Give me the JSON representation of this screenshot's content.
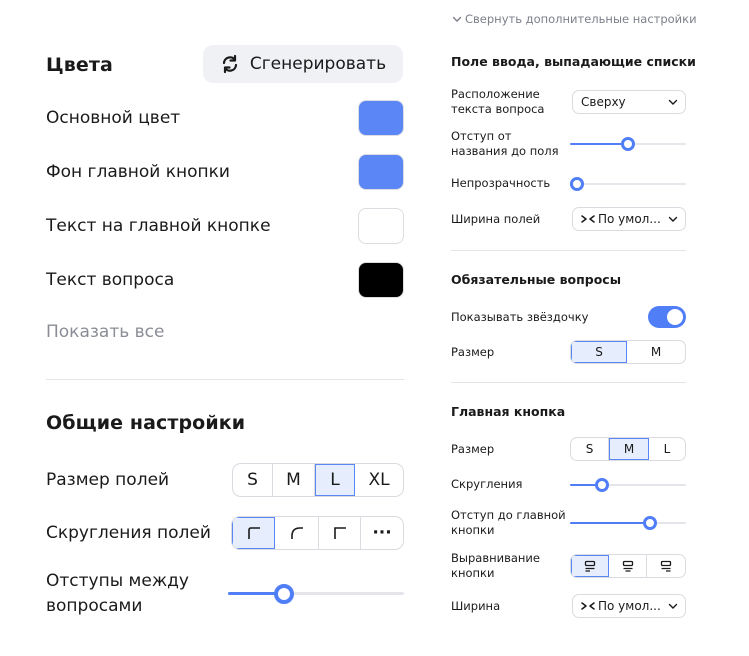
{
  "colors": {
    "title": "Цвета",
    "generate_label": "Сгенерировать",
    "items": [
      {
        "label": "Основной цвет",
        "color": "#5b86f5"
      },
      {
        "label": "Фон главной кнопки",
        "color": "#5b86f5"
      },
      {
        "label": "Текст на главной кнопке",
        "color": "#ffffff"
      },
      {
        "label": "Текст вопроса",
        "color": "#000000"
      }
    ],
    "show_all": "Показать все"
  },
  "general": {
    "title": "Общие настройки",
    "field_size": {
      "label": "Размер полей",
      "options": [
        "S",
        "M",
        "L",
        "XL"
      ],
      "selected": "L"
    },
    "field_rounding": {
      "label": "Скругления полей",
      "options": [
        "corner-square-icon",
        "corner-round-icon",
        "corner-sharp-icon",
        "more-icon"
      ],
      "more": "···",
      "selected_index": 0
    },
    "question_spacing": {
      "label": "Отступы между вопросами",
      "value": 0.32
    }
  },
  "advanced": {
    "collapse_label": "Свернуть дополнительные настройки",
    "inputs": {
      "title": "Поле ввода, выпадающие списки",
      "question_text_position": {
        "label": "Расположение текста вопроса",
        "value": "Сверху"
      },
      "field_title_offset": {
        "label": "Отступ от названия до поля",
        "value": 0.5
      },
      "opacity": {
        "label": "Непрозрачность",
        "value": 0.0
      },
      "field_width": {
        "label": "Ширина полей",
        "value": "По умол..."
      }
    },
    "required": {
      "title": "Обязательные вопросы",
      "show_asterisk": {
        "label": "Показывать звёздочку",
        "on": true
      },
      "size": {
        "label": "Размер",
        "options": [
          "S",
          "M"
        ],
        "selected": "S"
      }
    },
    "main_button": {
      "title": "Главная кнопка",
      "size": {
        "label": "Размер",
        "options": [
          "S",
          "M",
          "L"
        ],
        "selected": "M"
      },
      "rounding": {
        "label": "Скругления",
        "value": 0.28
      },
      "offset": {
        "label": "Отступ до главной кнопки",
        "value": 0.69
      },
      "alignment": {
        "label": "Выравнивание кнопки",
        "options": [
          "align-left-icon",
          "align-center-icon",
          "align-right-icon"
        ],
        "selected_index": 0
      },
      "width": {
        "label": "Ширина",
        "value": "По умол..."
      }
    }
  },
  "theme": {
    "accent": "#4f7ef7",
    "active_bg": "#e6edfd",
    "muted_text": "#8a8d96"
  }
}
